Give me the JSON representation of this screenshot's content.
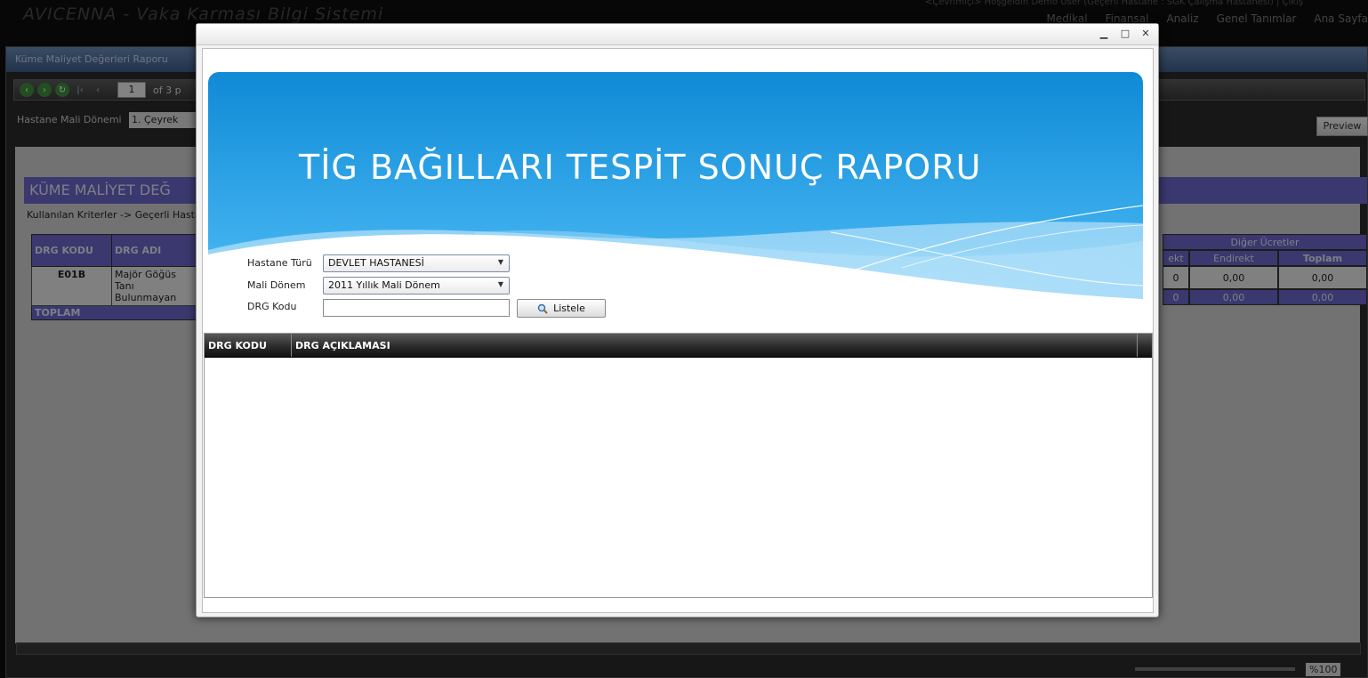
{
  "app": {
    "title": "AVICENNA - Vaka Karması Bilgi Sistemi",
    "user_info": "<Çevrimiçi> Hoşgeldin Demo User (Geçerli Hastane : SGK Çalışma Hastanesi) | Çıkış",
    "nav": [
      "Medikal",
      "Finansal",
      "Analiz",
      "Genel Tanımlar",
      "Ana Sayfa"
    ]
  },
  "report_window": {
    "title": "Küme Maliyet Değerleri Raporu",
    "toolbar": {
      "page_value": "1",
      "page_of": "of 3 p"
    },
    "period_label": "Hastane Mali Dönemi",
    "period_value": "1. Çeyrek",
    "preview_label": "Preview",
    "heading": "KÜME MALİYET DEĞ",
    "criteria": "Kullanılan Kriterler -> Geçerli Hastan",
    "table": {
      "headers": [
        "DRG KODU",
        "DRG ADI"
      ],
      "row": {
        "code": "E01B",
        "name": "Majör Göğüs Tanı Bulunmayan"
      },
      "total_label": "TOPLAM"
    },
    "right_table": {
      "group": "Diğer Ücretler",
      "subheaders": [
        "ekt",
        "Endirekt",
        "Toplam"
      ],
      "row_values": [
        "0",
        "0,00",
        "0,00"
      ],
      "total_values": [
        "0",
        "0,00",
        "0,00"
      ]
    },
    "zoom": "%100"
  },
  "modal": {
    "controls": {
      "minimize": "▁",
      "maximize": "□",
      "close": "✕"
    },
    "report_title": "TİG BAĞILLARI TESPİT SONUÇ RAPORU",
    "form": {
      "hastane_turu_label": "Hastane Türü",
      "hastane_turu_value": "DEVLET HASTANESİ",
      "mali_donem_label": "Mali Dönem",
      "mali_donem_value": "2011 Yıllık Mali Dönem",
      "drg_kodu_label": "DRG Kodu",
      "drg_kodu_value": "",
      "listele_label": "Listele"
    },
    "grid": {
      "columns": [
        "DRG KODU",
        "DRG AÇIKLAMASI"
      ]
    },
    "colors": {
      "banner_top": "#1a8fdc",
      "banner_bottom": "#7cc7f2",
      "grid_header": "#2b2b2b"
    }
  }
}
